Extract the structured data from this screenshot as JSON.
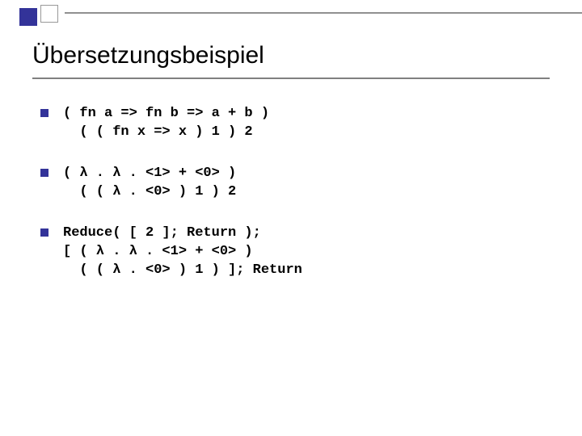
{
  "title": "Übersetzungsbeispiel",
  "items": [
    {
      "code": "( fn a => fn b => a + b )\n  ( ( fn x => x ) 1 ) 2"
    },
    {
      "code": "( λ . λ . <1> + <0> )\n  ( ( λ . <0> ) 1 ) 2"
    },
    {
      "code": "Reduce( [ 2 ]; Return );\n[ ( λ . λ . <1> + <0> )\n  ( ( λ . <0> ) 1 ) ]; Return"
    }
  ]
}
